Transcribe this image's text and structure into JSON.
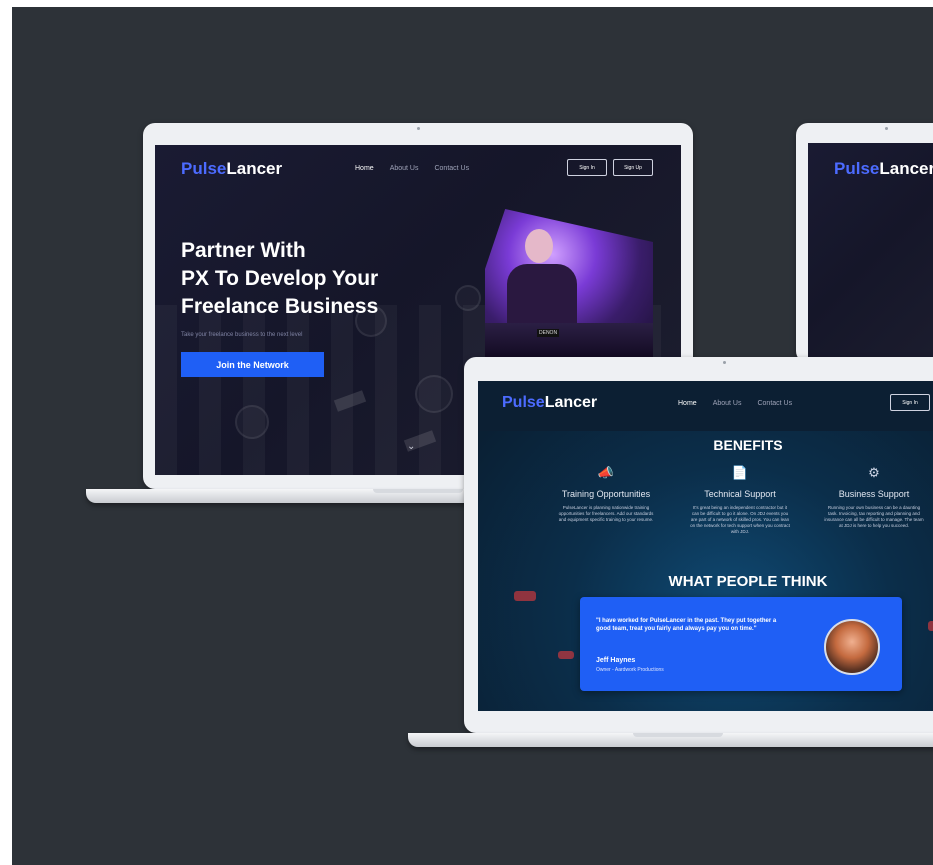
{
  "brand": {
    "part1": "Pulse",
    "part2": "Lancer",
    "accent": "#4c6bff",
    "button_blue": "#1f5ff5",
    "background": "#2d3238"
  },
  "nav": {
    "home": "Home",
    "about": "About Us",
    "contact": "Contact Us"
  },
  "auth": {
    "sign_in": "Sign In",
    "sign_up": "Sign Up"
  },
  "hero": {
    "title_line1": "Partner With",
    "title_line2": "PX To Develop Your",
    "title_line3": "Freelance Business",
    "subtitle": "Take your freelance business to the next level",
    "cta": "Join the Network",
    "image_label": "DENON",
    "scroll_icon": "chevron-down-icon"
  },
  "benefits": {
    "heading": "BENEFITS",
    "items": [
      {
        "icon": "megaphone-icon",
        "glyph": "📣",
        "title": "Training Opportunities",
        "desc": "PulseLancer is planning nationwide training opportunities for freelancers. Add our standards and equipment specific training to your resume."
      },
      {
        "icon": "document-icon",
        "glyph": "📄",
        "title": "Technical Support",
        "desc": "It's great being an independent contractor but it can be difficult to go it alone. On JDJ events you are part of a network of skilled pros. You can lean on the network for tech support when you contract with JDJ."
      },
      {
        "icon": "gears-icon",
        "glyph": "⚙",
        "title": "Business Support",
        "desc": "Running your own business can be a daunting task. Invoicing, tax reporting and planning and insurance can all be difficult to manage. The team at JDJ is here to help you succeed."
      }
    ]
  },
  "testimonials": {
    "heading": "WHAT PEOPLE THINK",
    "quote": "\"I have worked for PulseLancer in the past. They put together a good team, treat you fairly and always pay you on time.\"",
    "author": "Jeff Haynes",
    "role": "Owner - Aardwork Productions"
  }
}
